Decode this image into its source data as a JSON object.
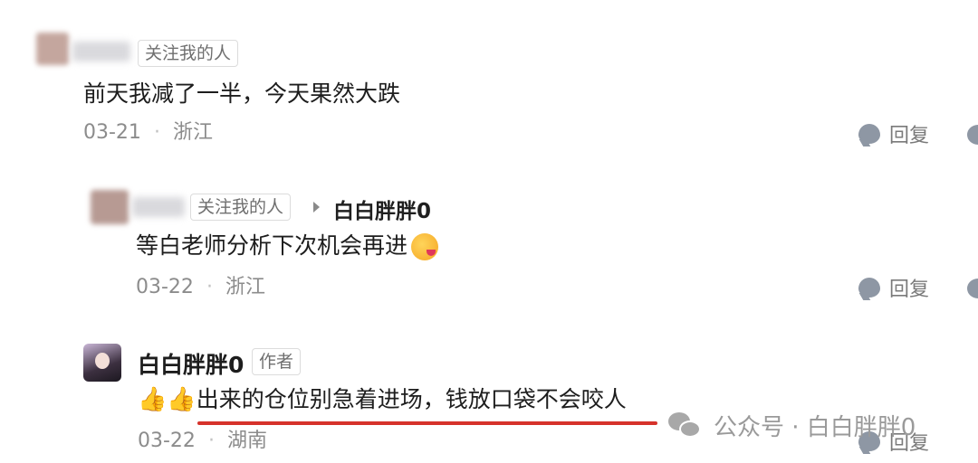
{
  "comments": [
    {
      "follow_tag": "关注我的人",
      "text": "前天我减了一半，今天果然大跌",
      "date": "03-21",
      "location": "浙江",
      "reply_label": "回复"
    },
    {
      "follow_tag": "关注我的人",
      "reply_to": "白白胖胖0",
      "text": "等白老师分析下次机会再进",
      "date": "03-22",
      "location": "浙江",
      "reply_label": "回复"
    },
    {
      "author_name": "白白胖胖0",
      "author_tag": "作者",
      "text": "出来的仓位别急着进场，钱放口袋不会咬人",
      "date": "03-22",
      "location": "湖南",
      "reply_label": "回复"
    }
  ],
  "watermark": {
    "text": "公众号 · 白白胖胖0"
  },
  "separator": "·",
  "icons": {
    "reply": "comment-bubble-icon",
    "thumbs": "thumbs-up-icon",
    "emoji": "tongue-wink-face-icon",
    "watermark": "wechat-icon",
    "reply_arrow": "right-triangle-icon"
  },
  "colors": {
    "highlight_line": "#d6322b",
    "meta_text": "#8c8c8c"
  }
}
